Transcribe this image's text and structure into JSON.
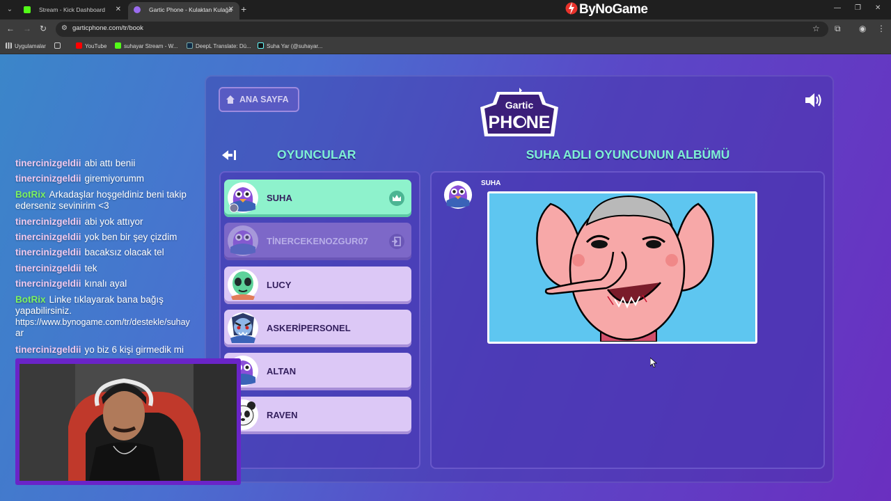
{
  "browser": {
    "tabs": [
      {
        "label": "Stream - Kick Dashboard",
        "active": false,
        "favicon_color": "#53fc18"
      },
      {
        "label": "Gartic Phone - Kulaktan Kulağa",
        "active": true,
        "favicon_color": "#9b6cf0"
      }
    ],
    "brand": "ByNoGame",
    "url": "garticphone.com/tr/book",
    "bookmarks": [
      "Uygulamalar",
      "YouTube",
      "suhayar Stream - W...",
      "DeepL Translate: Dü...",
      "Suha Yar (@suhayar..."
    ]
  },
  "game": {
    "home_button": "ANA SAYFA",
    "logo_top": "Gartic",
    "logo_bottom": "PHONE",
    "players_heading": "OYUNCULAR",
    "album_heading": "SUHA ADLI OYUNCUNUN ALBÜMÜ",
    "players": [
      {
        "name": "SUHA",
        "status": "host"
      },
      {
        "name": "TİNERCEKENOZGUR07",
        "status": "left"
      },
      {
        "name": "LUCY",
        "status": "normal"
      },
      {
        "name": "ASKERİPERSONEL",
        "status": "normal"
      },
      {
        "name": "ALTAN",
        "status": "normal"
      },
      {
        "name": "RAVEN",
        "status": "normal"
      }
    ],
    "album_author": "SUHA"
  },
  "chat": [
    {
      "user": "tinercinizgeldii",
      "msg": "abi attı benii",
      "kind": "viewer"
    },
    {
      "user": "tinercinizgeldii",
      "msg": "giremiyorumm",
      "kind": "viewer"
    },
    {
      "user": "BotRix",
      "msg": "Arkadaşlar hoşgeldiniz beni takip",
      "msg2": "ederseniz sevinirim <3",
      "kind": "bot"
    },
    {
      "user": "tinercinizgeldii",
      "msg": "abi yok attıyor",
      "kind": "viewer"
    },
    {
      "user": "tinercinizgeldii",
      "msg": "yok ben bir şey çizdim",
      "kind": "viewer"
    },
    {
      "user": "tinercinizgeldii",
      "msg": "bacaksız olacak tel",
      "kind": "viewer"
    },
    {
      "user": "tinercinizgeldii",
      "msg": "tek",
      "kind": "viewer"
    },
    {
      "user": "tinercinizgeldii",
      "msg": "kınalı ayal",
      "kind": "viewer"
    },
    {
      "user": "BotRix",
      "msg": "Linke tıklayarak bana bağış",
      "msg2": "yapabilirsiniz.",
      "msg3": "https://www.bynogame.com/tr/destekle/suhay",
      "msg4": "ar",
      "kind": "bot"
    },
    {
      "user": "tinercinizgeldii",
      "msg": "yo biz 6 kişi girmedik mi",
      "kind": "viewer"
    }
  ],
  "colors": {
    "accent_heading": "#7ef0d3",
    "host_row": "#8ef2cc",
    "player_row": "#dcc8f6",
    "webcam_frame": "#6a24c8"
  }
}
